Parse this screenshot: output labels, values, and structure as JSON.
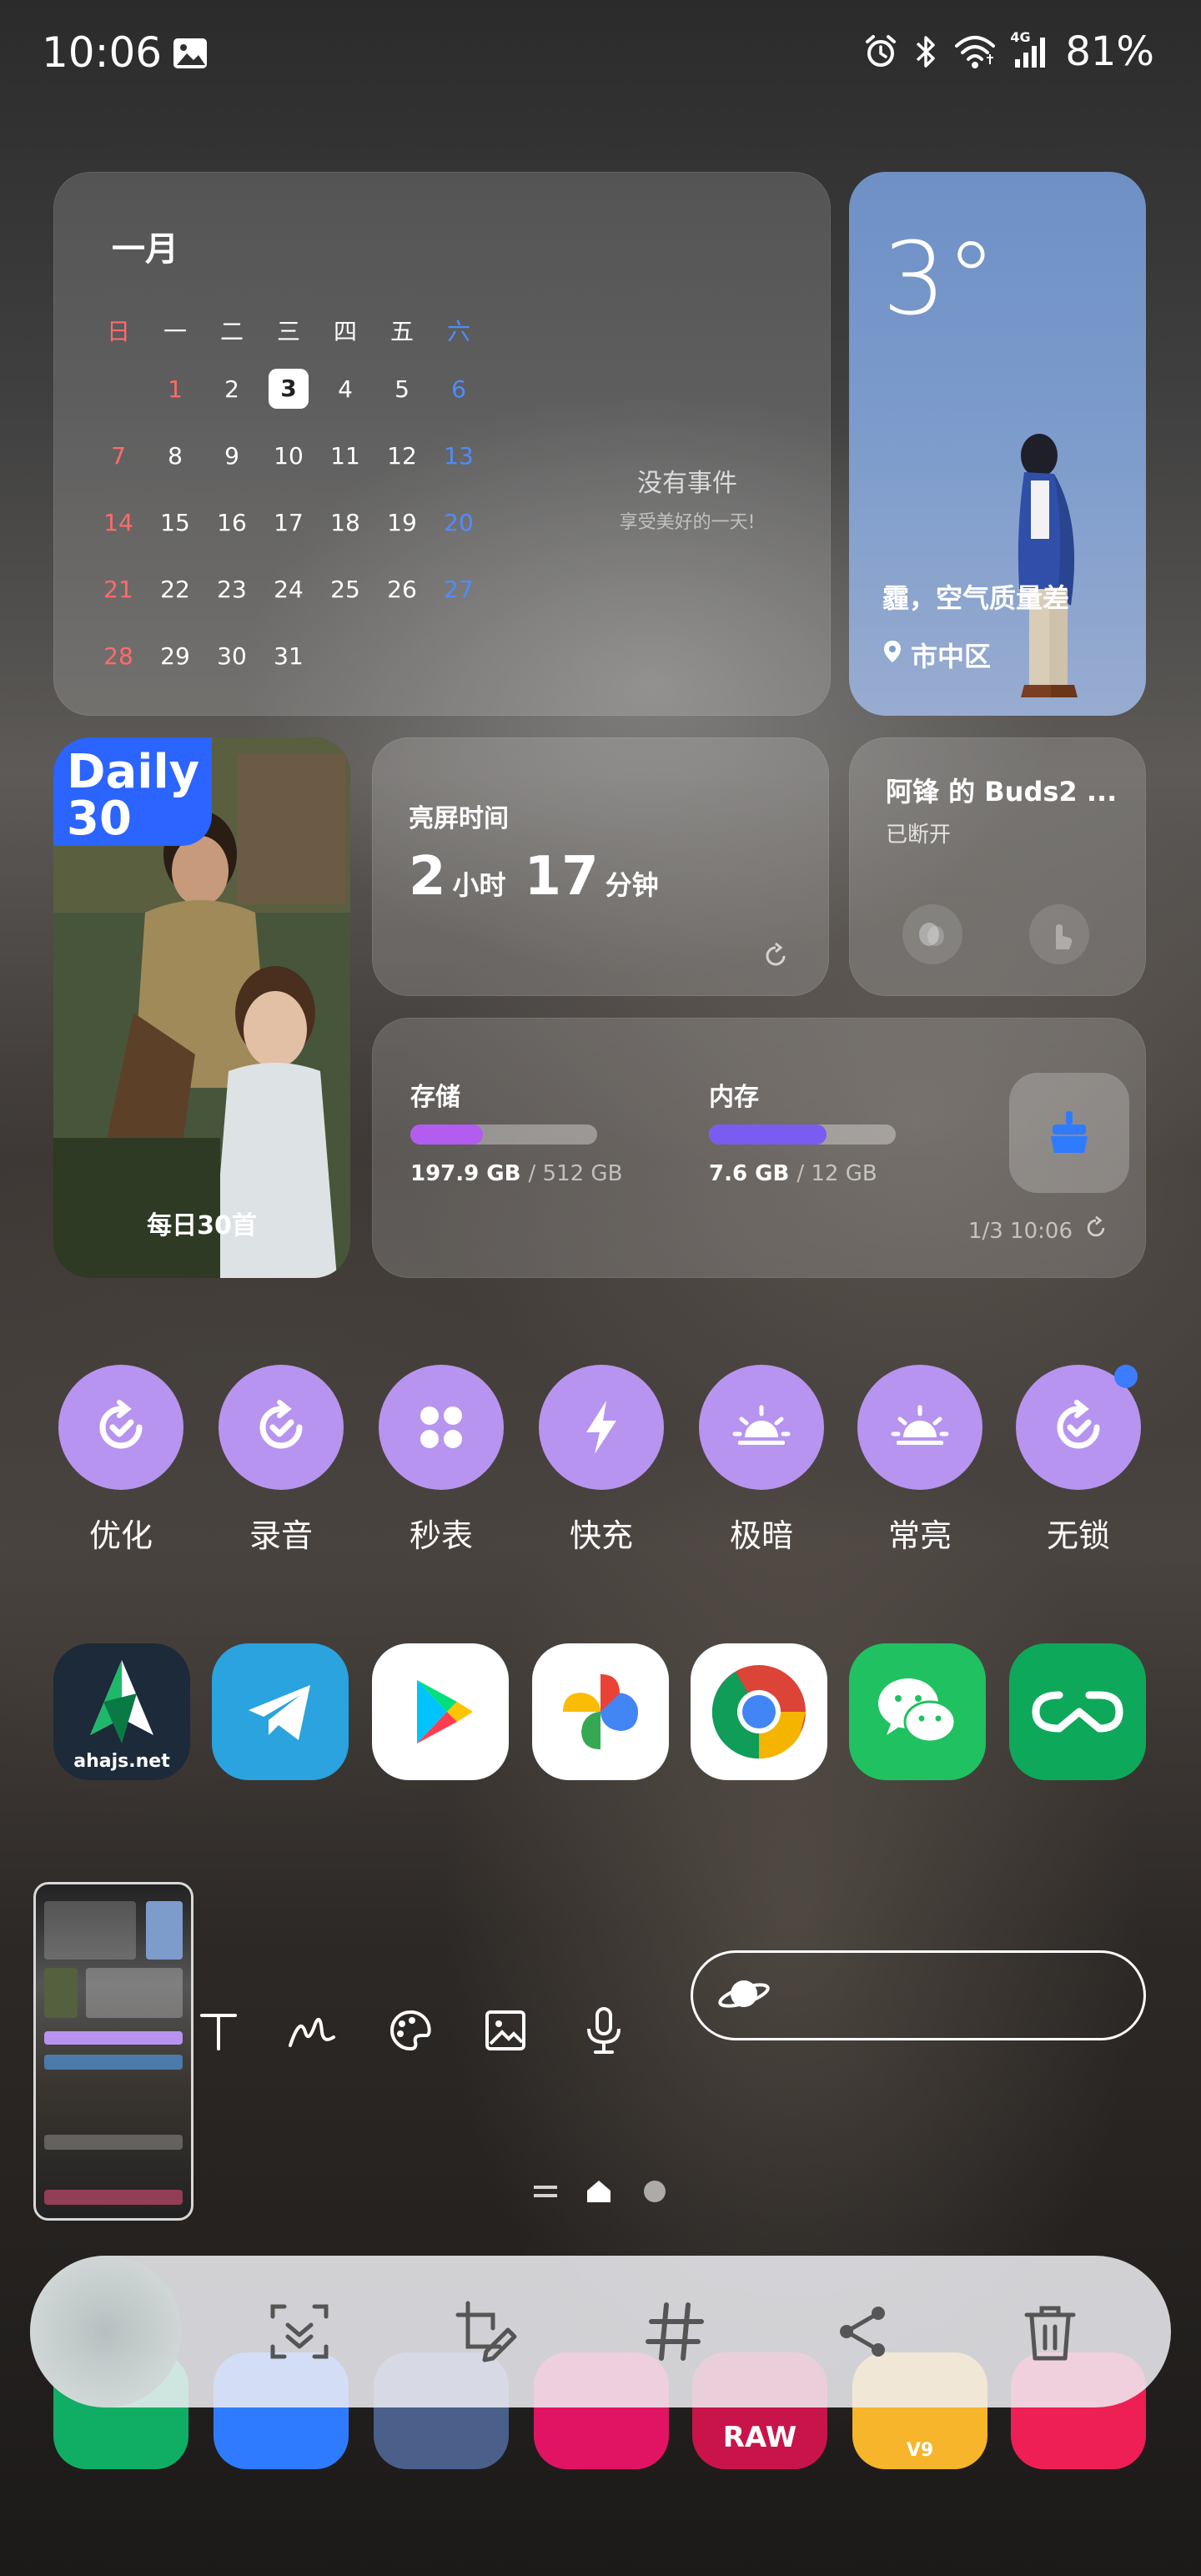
{
  "status_bar": {
    "time": "10:06",
    "battery": "81%",
    "network": "4G"
  },
  "calendar": {
    "month": "一月",
    "weekdays": [
      "日",
      "一",
      "二",
      "三",
      "四",
      "五",
      "六"
    ],
    "weeks": [
      [
        "",
        "1",
        "2",
        "3",
        "4",
        "5",
        "6"
      ],
      [
        "7",
        "8",
        "9",
        "10",
        "11",
        "12",
        "13"
      ],
      [
        "14",
        "15",
        "16",
        "17",
        "18",
        "19",
        "20"
      ],
      [
        "21",
        "22",
        "23",
        "24",
        "25",
        "26",
        "27"
      ],
      [
        "28",
        "29",
        "30",
        "31",
        "",
        "",
        ""
      ]
    ],
    "today": "3",
    "no_events": "没有事件",
    "no_events_sub": "享受美好的一天!"
  },
  "weather": {
    "temp": "3°",
    "desc": "霾，空气质量差",
    "location": "市中区"
  },
  "daily": {
    "logo_line1": "Daily",
    "logo_line2": "30",
    "caption": "每日30首"
  },
  "screen_time": {
    "title": "亮屏时间",
    "hours": "2",
    "hours_unit": "小时",
    "minutes": "17",
    "minutes_unit": "分钟"
  },
  "buds": {
    "title": "阿锋 的 Buds2 ...",
    "status": "已断开"
  },
  "storage": {
    "storage_label": "存储",
    "storage_used": "197.9 GB",
    "storage_total": "/ 512 GB",
    "storage_fraction": 0.387,
    "memory_label": "内存",
    "memory_used": "7.6 GB",
    "memory_total": "/ 12 GB",
    "memory_fraction": 0.63,
    "updated": "1/3 10:06"
  },
  "shortcuts": [
    {
      "label": "优化",
      "icon": "check-refresh-icon"
    },
    {
      "label": "录音",
      "icon": "check-refresh-icon"
    },
    {
      "label": "秒表",
      "icon": "four-dots-icon"
    },
    {
      "label": "快充",
      "icon": "bolt-icon"
    },
    {
      "label": "极暗",
      "icon": "sunset-icon"
    },
    {
      "label": "常亮",
      "icon": "sunrise-icon"
    },
    {
      "label": "无锁",
      "icon": "check-refresh-icon"
    }
  ],
  "apps": [
    {
      "name": "ahajs",
      "label": "ahajs.net",
      "color": "#1c2a3a"
    },
    {
      "name": "telegram",
      "color": "#2aa3de"
    },
    {
      "name": "google-play",
      "color": "#ffffff"
    },
    {
      "name": "google-photos",
      "color": "#ffffff"
    },
    {
      "name": "chrome",
      "color": "#ffffff"
    },
    {
      "name": "wechat",
      "color": "#20c160"
    },
    {
      "name": "wps",
      "color": "#0ea85b"
    }
  ],
  "dock_partial": {
    "raw_label": "RAW",
    "v9_label": "V9"
  },
  "colors": {
    "accent_purple": "#b794f0",
    "storage_bar": "#b35cf0",
    "memory_bar": "#7b5cf0",
    "notification_dot": "#3d7cff"
  }
}
